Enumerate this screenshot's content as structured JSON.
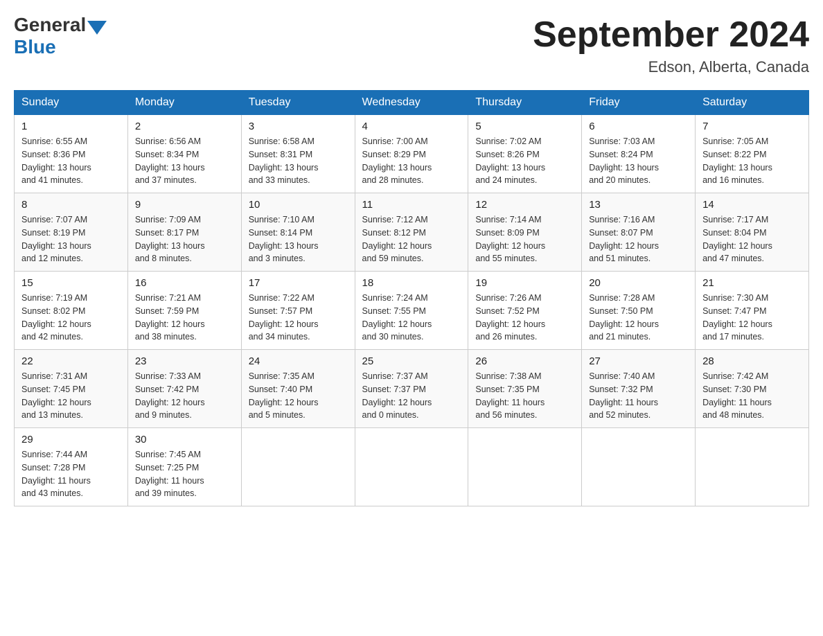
{
  "header": {
    "logo_general": "General",
    "logo_blue": "Blue",
    "title": "September 2024",
    "location": "Edson, Alberta, Canada"
  },
  "days_of_week": [
    "Sunday",
    "Monday",
    "Tuesday",
    "Wednesday",
    "Thursday",
    "Friday",
    "Saturday"
  ],
  "weeks": [
    [
      {
        "day": "1",
        "sunrise": "6:55 AM",
        "sunset": "8:36 PM",
        "daylight": "13 hours and 41 minutes."
      },
      {
        "day": "2",
        "sunrise": "6:56 AM",
        "sunset": "8:34 PM",
        "daylight": "13 hours and 37 minutes."
      },
      {
        "day": "3",
        "sunrise": "6:58 AM",
        "sunset": "8:31 PM",
        "daylight": "13 hours and 33 minutes."
      },
      {
        "day": "4",
        "sunrise": "7:00 AM",
        "sunset": "8:29 PM",
        "daylight": "13 hours and 28 minutes."
      },
      {
        "day": "5",
        "sunrise": "7:02 AM",
        "sunset": "8:26 PM",
        "daylight": "13 hours and 24 minutes."
      },
      {
        "day": "6",
        "sunrise": "7:03 AM",
        "sunset": "8:24 PM",
        "daylight": "13 hours and 20 minutes."
      },
      {
        "day": "7",
        "sunrise": "7:05 AM",
        "sunset": "8:22 PM",
        "daylight": "13 hours and 16 minutes."
      }
    ],
    [
      {
        "day": "8",
        "sunrise": "7:07 AM",
        "sunset": "8:19 PM",
        "daylight": "13 hours and 12 minutes."
      },
      {
        "day": "9",
        "sunrise": "7:09 AM",
        "sunset": "8:17 PM",
        "daylight": "13 hours and 8 minutes."
      },
      {
        "day": "10",
        "sunrise": "7:10 AM",
        "sunset": "8:14 PM",
        "daylight": "13 hours and 3 minutes."
      },
      {
        "day": "11",
        "sunrise": "7:12 AM",
        "sunset": "8:12 PM",
        "daylight": "12 hours and 59 minutes."
      },
      {
        "day": "12",
        "sunrise": "7:14 AM",
        "sunset": "8:09 PM",
        "daylight": "12 hours and 55 minutes."
      },
      {
        "day": "13",
        "sunrise": "7:16 AM",
        "sunset": "8:07 PM",
        "daylight": "12 hours and 51 minutes."
      },
      {
        "day": "14",
        "sunrise": "7:17 AM",
        "sunset": "8:04 PM",
        "daylight": "12 hours and 47 minutes."
      }
    ],
    [
      {
        "day": "15",
        "sunrise": "7:19 AM",
        "sunset": "8:02 PM",
        "daylight": "12 hours and 42 minutes."
      },
      {
        "day": "16",
        "sunrise": "7:21 AM",
        "sunset": "7:59 PM",
        "daylight": "12 hours and 38 minutes."
      },
      {
        "day": "17",
        "sunrise": "7:22 AM",
        "sunset": "7:57 PM",
        "daylight": "12 hours and 34 minutes."
      },
      {
        "day": "18",
        "sunrise": "7:24 AM",
        "sunset": "7:55 PM",
        "daylight": "12 hours and 30 minutes."
      },
      {
        "day": "19",
        "sunrise": "7:26 AM",
        "sunset": "7:52 PM",
        "daylight": "12 hours and 26 minutes."
      },
      {
        "day": "20",
        "sunrise": "7:28 AM",
        "sunset": "7:50 PM",
        "daylight": "12 hours and 21 minutes."
      },
      {
        "day": "21",
        "sunrise": "7:30 AM",
        "sunset": "7:47 PM",
        "daylight": "12 hours and 17 minutes."
      }
    ],
    [
      {
        "day": "22",
        "sunrise": "7:31 AM",
        "sunset": "7:45 PM",
        "daylight": "12 hours and 13 minutes."
      },
      {
        "day": "23",
        "sunrise": "7:33 AM",
        "sunset": "7:42 PM",
        "daylight": "12 hours and 9 minutes."
      },
      {
        "day": "24",
        "sunrise": "7:35 AM",
        "sunset": "7:40 PM",
        "daylight": "12 hours and 5 minutes."
      },
      {
        "day": "25",
        "sunrise": "7:37 AM",
        "sunset": "7:37 PM",
        "daylight": "12 hours and 0 minutes."
      },
      {
        "day": "26",
        "sunrise": "7:38 AM",
        "sunset": "7:35 PM",
        "daylight": "11 hours and 56 minutes."
      },
      {
        "day": "27",
        "sunrise": "7:40 AM",
        "sunset": "7:32 PM",
        "daylight": "11 hours and 52 minutes."
      },
      {
        "day": "28",
        "sunrise": "7:42 AM",
        "sunset": "7:30 PM",
        "daylight": "11 hours and 48 minutes."
      }
    ],
    [
      {
        "day": "29",
        "sunrise": "7:44 AM",
        "sunset": "7:28 PM",
        "daylight": "11 hours and 43 minutes."
      },
      {
        "day": "30",
        "sunrise": "7:45 AM",
        "sunset": "7:25 PM",
        "daylight": "11 hours and 39 minutes."
      },
      null,
      null,
      null,
      null,
      null
    ]
  ],
  "labels": {
    "sunrise": "Sunrise:",
    "sunset": "Sunset:",
    "daylight": "Daylight:"
  }
}
